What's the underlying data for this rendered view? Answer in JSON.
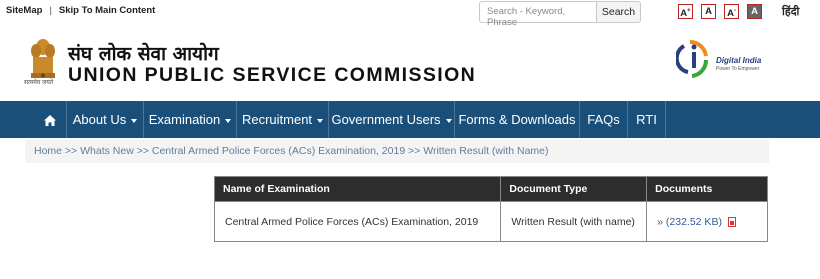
{
  "top": {
    "sitemap": "SiteMap",
    "separator": "|",
    "skip": "Skip To Main Content",
    "search_placeholder": "Search - Keyword, Phrase",
    "search_button": "Search",
    "font_increase": "A",
    "font_increase_sup": "+",
    "font_normal": "A",
    "font_decrease": "A",
    "font_decrease_sup": "-",
    "font_contrast": "A",
    "language": "हिंदी"
  },
  "header": {
    "emblem_caption": "सत्यमेव जयते",
    "title_hindi": "संघ लोक सेवा आयोग",
    "title_english": "UNION PUBLIC SERVICE COMMISSION",
    "digital_india": "Digital India",
    "digital_india_tag": "Power To Empower"
  },
  "nav": {
    "items": [
      {
        "label": "About Us"
      },
      {
        "label": "Examination"
      },
      {
        "label": "Recruitment"
      },
      {
        "label": "Government Users"
      },
      {
        "label": "Forms & Downloads"
      },
      {
        "label": "FAQs"
      },
      {
        "label": "RTI"
      }
    ]
  },
  "breadcrumb": {
    "text": "Home >> Whats New >> Central Armed Police Forces (ACs) Examination, 2019 >> Written Result (with Name)"
  },
  "table": {
    "headers": [
      "Name of Examination",
      "Document Type",
      "Documents"
    ],
    "rows": [
      {
        "exam": "Central Armed Police Forces (ACs) Examination, 2019",
        "doc_type": "Written Result (with name)",
        "arrow": "»",
        "size": "(232.52 KB)"
      }
    ]
  },
  "colors": {
    "nav_bg": "#1a4f79",
    "table_header_bg": "#2d2d2d",
    "link": "#2f5f92"
  }
}
